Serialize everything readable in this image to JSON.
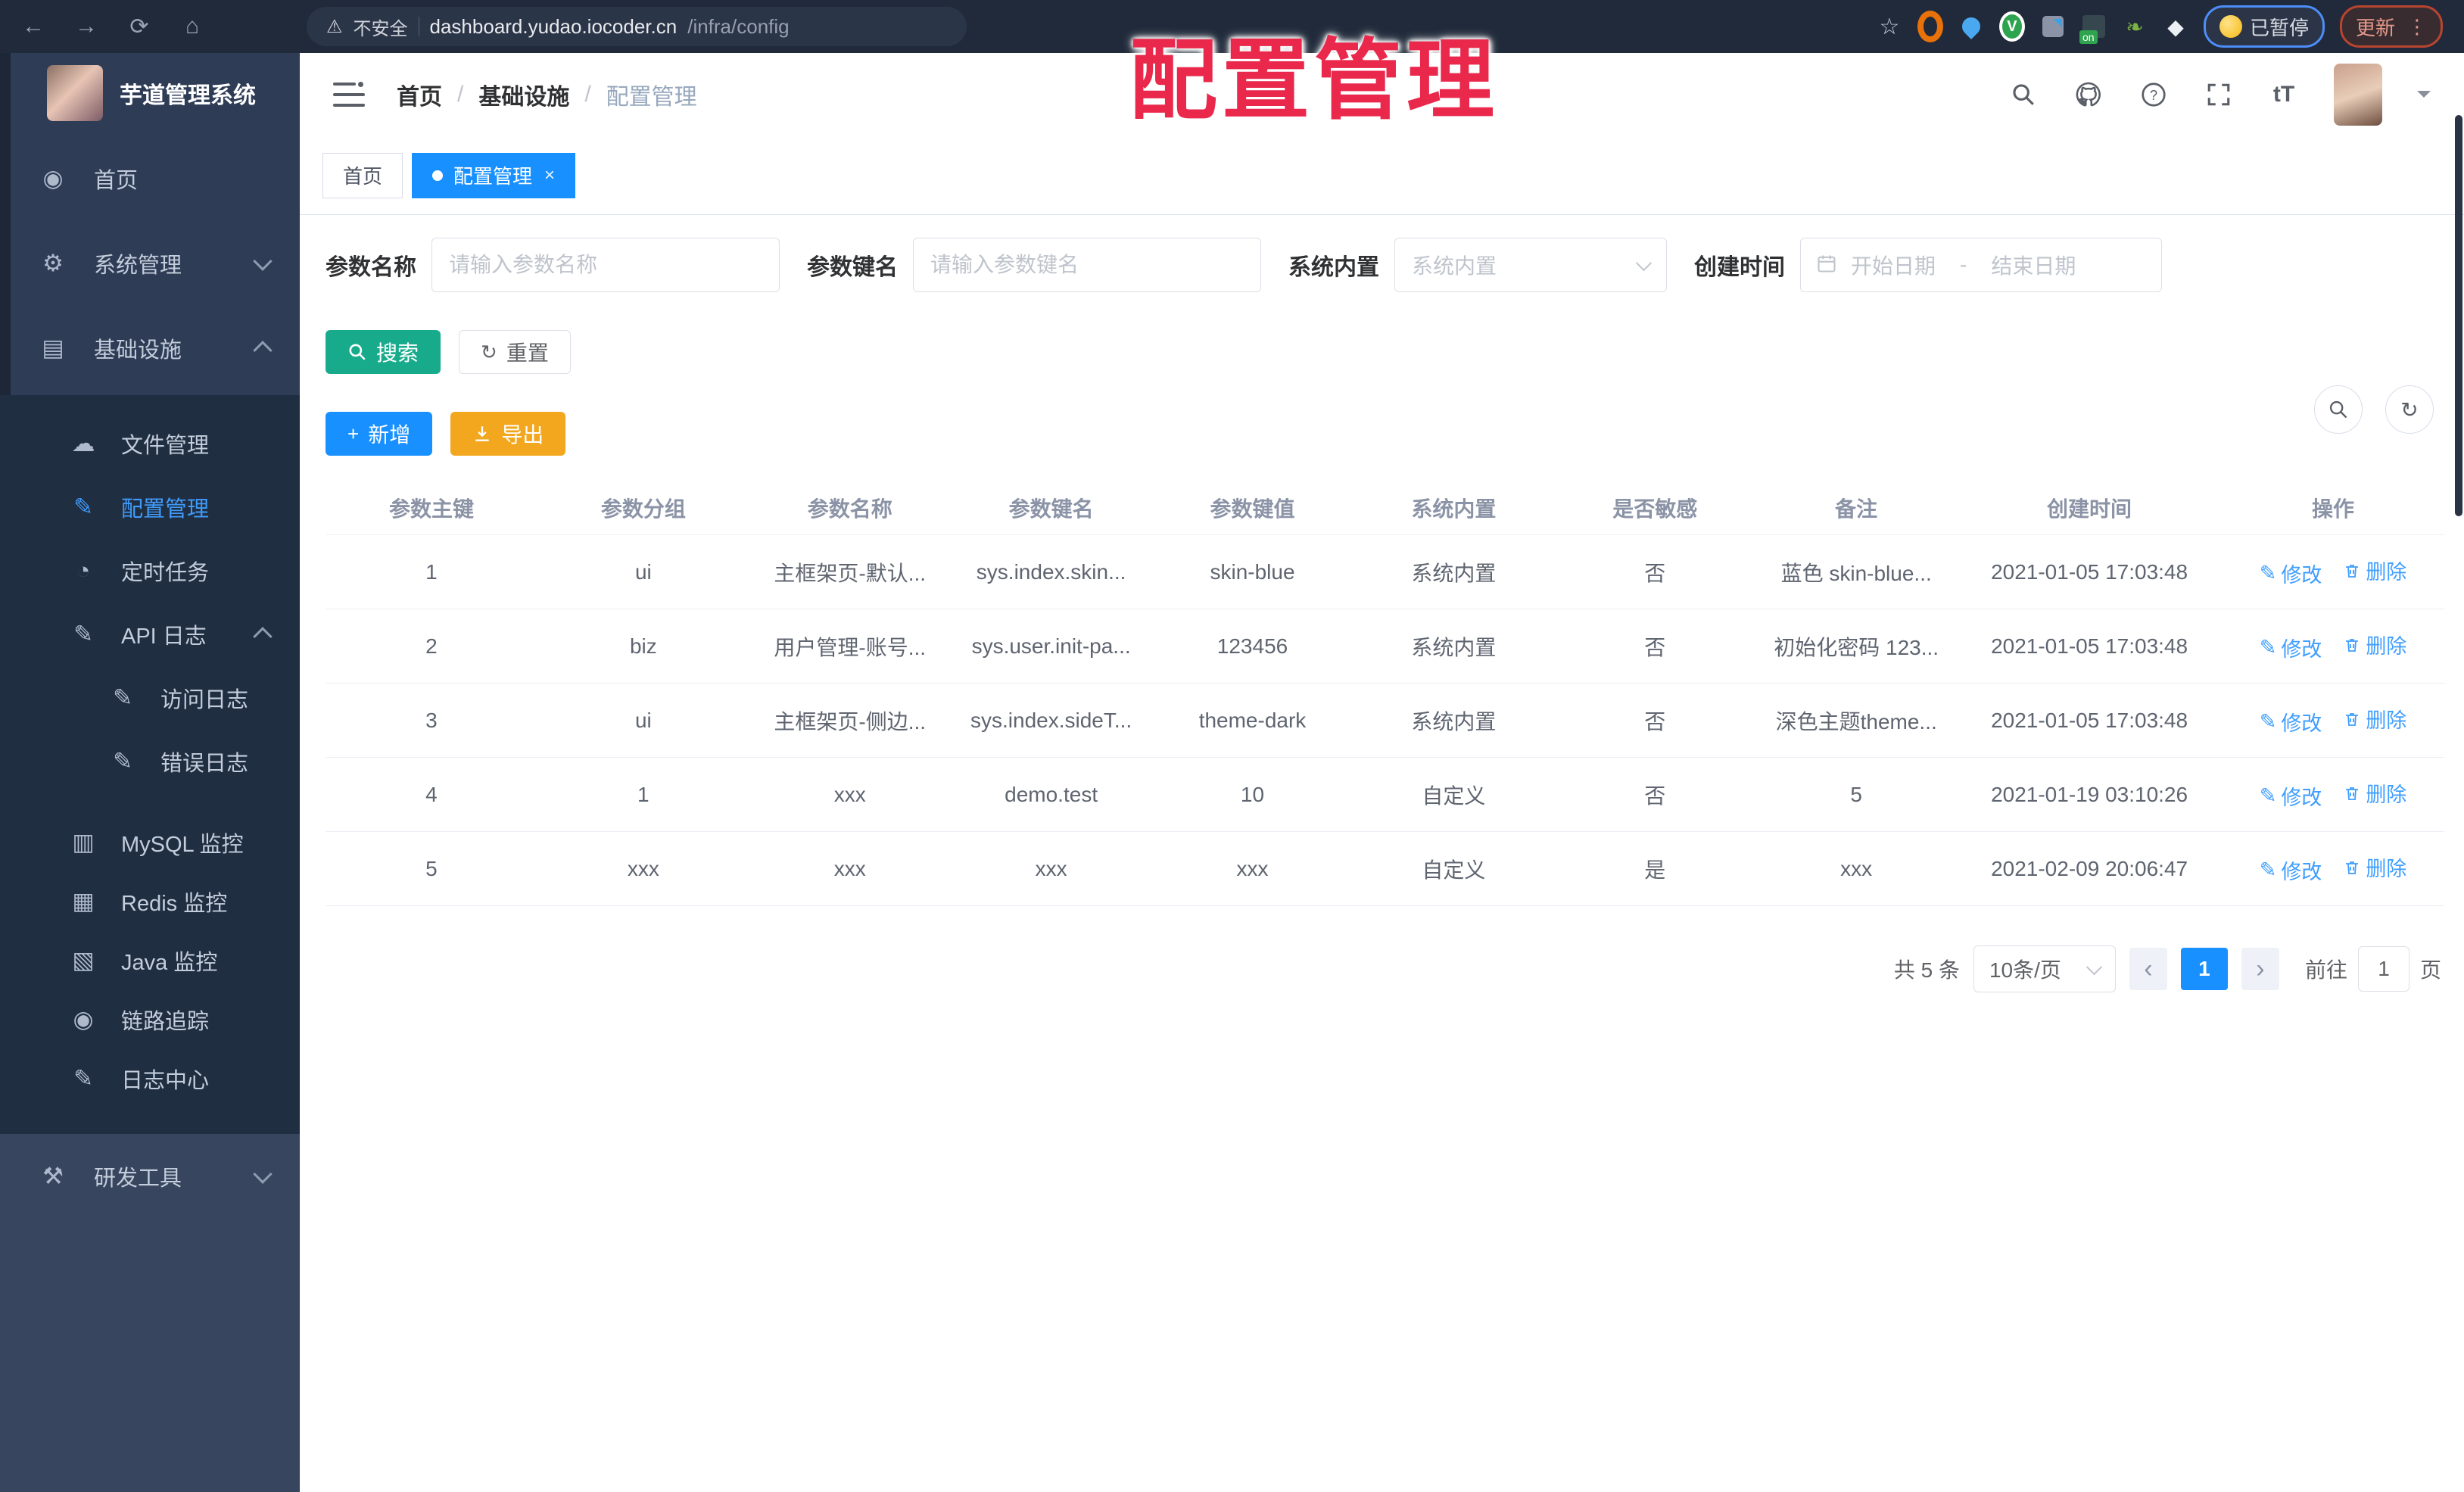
{
  "browser": {
    "security_label": "不安全",
    "url_domain": "dashboard.yudao.iocoder.cn",
    "url_path": "/infra/config",
    "paused_label": "已暂停",
    "update_label": "更新"
  },
  "overlay_title": "配置管理",
  "sidebar": {
    "app_title": "芋道管理系统",
    "items": [
      {
        "label": "首页",
        "icon": "dashboard-icon",
        "glyph": "◉"
      },
      {
        "label": "系统管理",
        "icon": "gear-icon",
        "glyph": "⚙"
      },
      {
        "label": "基础设施",
        "icon": "infra-icon",
        "glyph": "▤"
      },
      {
        "label": "文件管理",
        "icon": "cloud-upload-icon",
        "glyph": "☁"
      },
      {
        "label": "配置管理",
        "icon": "edit-icon",
        "glyph": "✎"
      },
      {
        "label": "定时任务",
        "icon": "timer-icon",
        "glyph": "◔"
      },
      {
        "label": "API 日志",
        "icon": "log-icon",
        "glyph": "✎"
      },
      {
        "label": "访问日志",
        "icon": "access-log-icon",
        "glyph": "✎"
      },
      {
        "label": "错误日志",
        "icon": "error-log-icon",
        "glyph": "✎"
      },
      {
        "label": "MySQL 监控",
        "icon": "mysql-icon",
        "glyph": "▥"
      },
      {
        "label": "Redis 监控",
        "icon": "redis-icon",
        "glyph": "▦"
      },
      {
        "label": "Java 监控",
        "icon": "java-icon",
        "glyph": "▧"
      },
      {
        "label": "链路追踪",
        "icon": "trace-icon",
        "glyph": "◉"
      },
      {
        "label": "日志中心",
        "icon": "log-center-icon",
        "glyph": "✎"
      },
      {
        "label": "研发工具",
        "icon": "tools-icon",
        "glyph": "⚒"
      }
    ]
  },
  "header": {
    "breadcrumb": [
      "首页",
      "基础设施",
      "配置管理"
    ],
    "separator": "/"
  },
  "tabs": [
    {
      "label": "首页"
    },
    {
      "label": "配置管理",
      "close": "×"
    }
  ],
  "filters": {
    "name_label": "参数名称",
    "name_placeholder": "请输入参数名称",
    "key_label": "参数键名",
    "key_placeholder": "请输入参数键名",
    "type_label": "系统内置",
    "type_placeholder": "系统内置",
    "date_label": "创建时间",
    "date_start": "开始日期",
    "date_separator": "-",
    "date_end": "结束日期"
  },
  "actions": {
    "search": "搜索",
    "reset": "重置",
    "create": "新增",
    "export": "导出"
  },
  "table": {
    "columns": [
      "参数主键",
      "参数分组",
      "参数名称",
      "参数键名",
      "参数键值",
      "系统内置",
      "是否敏感",
      "备注",
      "创建时间",
      "操作"
    ],
    "edit_label": "修改",
    "delete_label": "删除",
    "rows": [
      {
        "id": "1",
        "group": "ui",
        "name": "主框架页-默认...",
        "key": "sys.index.skin...",
        "value": "skin-blue",
        "type": "系统内置",
        "sensitive": "否",
        "remark": "蓝色 skin-blue...",
        "created": "2021-01-05 17:03:48"
      },
      {
        "id": "2",
        "group": "biz",
        "name": "用户管理-账号...",
        "key": "sys.user.init-pa...",
        "value": "123456",
        "type": "系统内置",
        "sensitive": "否",
        "remark": "初始化密码 123...",
        "created": "2021-01-05 17:03:48"
      },
      {
        "id": "3",
        "group": "ui",
        "name": "主框架页-侧边...",
        "key": "sys.index.sideT...",
        "value": "theme-dark",
        "type": "系统内置",
        "sensitive": "否",
        "remark": "深色主题theme...",
        "created": "2021-01-05 17:03:48"
      },
      {
        "id": "4",
        "group": "1",
        "name": "xxx",
        "key": "demo.test",
        "value": "10",
        "type": "自定义",
        "sensitive": "否",
        "remark": "5",
        "created": "2021-01-19 03:10:26"
      },
      {
        "id": "5",
        "group": "xxx",
        "name": "xxx",
        "key": "xxx",
        "value": "xxx",
        "type": "自定义",
        "sensitive": "是",
        "remark": "xxx",
        "created": "2021-02-09 20:06:47"
      }
    ]
  },
  "pagination": {
    "total": "共 5 条",
    "page_size": "10条/页",
    "current_page": "1",
    "goto_label": "前往",
    "goto_value": "1",
    "page_unit": "页"
  },
  "colors": {
    "primary": "#1890ff",
    "success": "#17ab8b",
    "warning": "#f2a71f",
    "link": "#3f9eff",
    "overlay_red": "#e9284c",
    "sidebar_bg": "#2e3c56",
    "submenu_bg": "#202e42"
  }
}
